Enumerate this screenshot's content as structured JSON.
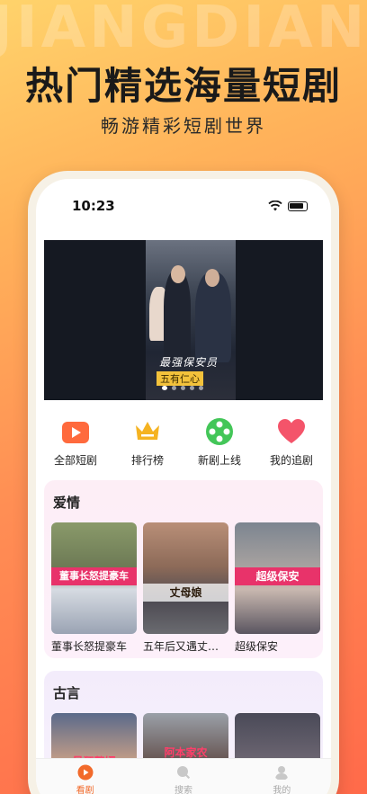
{
  "background_letters": "JIANGDIAN",
  "headline": "热门精选海量短剧",
  "subline": "畅游精彩短剧世界",
  "status_bar": {
    "time": "10:23"
  },
  "banner": {
    "title": "最强保安员",
    "subtitle": "五有仁心",
    "page_count": 5,
    "active_index": 0
  },
  "categories": [
    {
      "label": "全部短剧",
      "icon": "play-icon",
      "color": "#ff6a3d"
    },
    {
      "label": "排行榜",
      "icon": "crown-icon",
      "color": "#f5b321"
    },
    {
      "label": "新剧上线",
      "icon": "film-reel-icon",
      "color": "#43c658"
    },
    {
      "label": "我的追剧",
      "icon": "heart-icon",
      "color": "#f4546a"
    }
  ],
  "sections": [
    {
      "title": "爱情",
      "items": [
        {
          "title": "董事长怒提豪车",
          "tag": "董事长怒提豪车"
        },
        {
          "title": "五年后又遇丈母娘",
          "tag": "丈母娘"
        },
        {
          "title": "超级保安",
          "tag": "超级保安"
        }
      ]
    },
    {
      "title": "古言",
      "items": [
        {
          "title": "",
          "tag": "最狂赘婿"
        },
        {
          "title": "",
          "tag": "阿本家农"
        },
        {
          "title": "",
          "tag": ""
        }
      ]
    }
  ],
  "tabbar": [
    {
      "label": "看剧",
      "icon": "play-icon",
      "active": true
    },
    {
      "label": "搜索",
      "icon": "search-icon",
      "active": false
    },
    {
      "label": "我的",
      "icon": "user-icon",
      "active": false
    }
  ],
  "colors": {
    "accent": "#f26a2b",
    "headline": "#1a1a1a"
  }
}
